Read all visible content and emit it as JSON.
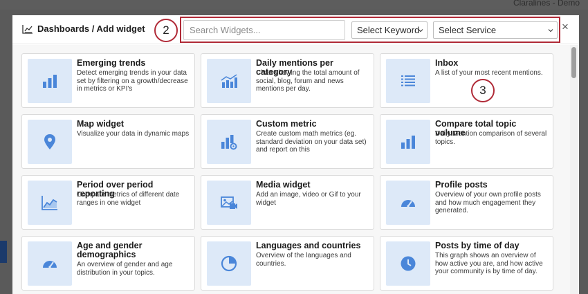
{
  "topbar": {
    "user": "Claralines - Demo"
  },
  "header": {
    "title": "Dashboards / Add widget",
    "search_placeholder": "Search Widgets...",
    "keyword_select": "Select Keyword",
    "service_select": "Select Service",
    "close_icon": "close-icon"
  },
  "callouts": {
    "two": "2",
    "three": "3"
  },
  "widgets": [
    {
      "title": "Emerging trends",
      "desc": "Detect emerging trends in your data set by filtering on a growth/decrease in metrics or KPI's",
      "icon": "bar-chart-icon"
    },
    {
      "title": "Daily mentions per category",
      "desc": "Chart showing the total amount of social, blog, forum and news mentions per day.",
      "icon": "bar-trend-icon"
    },
    {
      "title": "Inbox",
      "desc": "A list of your most recent mentions.",
      "icon": "list-icon"
    },
    {
      "title": "Map widget",
      "desc": "Visualize your data in dynamic maps",
      "icon": "map-pin-icon"
    },
    {
      "title": "Custom metric",
      "desc": "Create custom math metrics (eg. standard deviation on your data set) and report on this",
      "icon": "bar-gear-icon"
    },
    {
      "title": "Compare total topic volume",
      "desc": "Daily Mention comparison of several topics.",
      "icon": "bar-chart-icon"
    },
    {
      "title": "Period over period reporting",
      "desc": "Compare metrics of different date ranges in one widget",
      "icon": "area-chart-icon"
    },
    {
      "title": "Media widget",
      "desc": "Add an image, video or Gif to your widget",
      "icon": "media-icon"
    },
    {
      "title": "Profile posts",
      "desc": "Overview of your own profile posts and how much engagement they generated.",
      "icon": "gauge-icon"
    },
    {
      "title": "Age and gender demographics",
      "desc": "An overview of gender and age distribution in your topics.",
      "icon": "gauge-icon"
    },
    {
      "title": "Languages and countries",
      "desc": "Overview of the languages and countries.",
      "icon": "pie-icon"
    },
    {
      "title": "Posts by time of day",
      "desc": "This graph shows an overview of how active you are, and how active your community is by time of day.",
      "icon": "clock-icon"
    }
  ],
  "colors": {
    "accent": "#4a86d9",
    "tile": "#dde9f8",
    "callout": "#b02a37"
  }
}
